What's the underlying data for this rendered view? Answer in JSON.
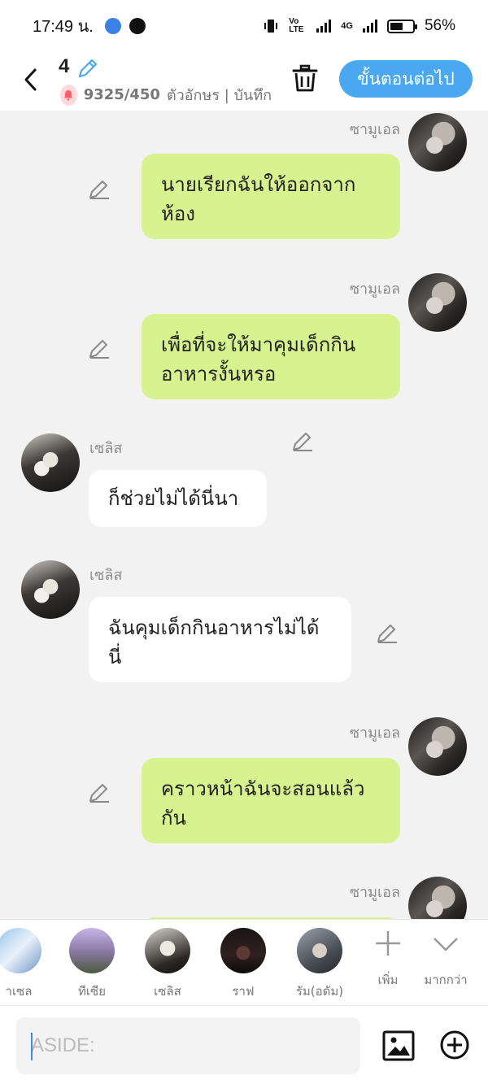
{
  "status_bar": {
    "time": "17:49 น.",
    "battery": "56%",
    "battery_level": 0.56,
    "network": "4G",
    "volte": "Vo LTE"
  },
  "header": {
    "episode_number": "4",
    "char_count": "9325/450",
    "char_count_suffix": "ตัวอักษร | บันทึก",
    "next_label": "ขั้นตอนต่อไป",
    "accent_color": "#4aa8f0"
  },
  "messages": [
    {
      "sender": "ซามูเอล",
      "side": "right",
      "text_lines": [
        "นายเรียกฉันให้ออกจาก",
        "ห้อง"
      ]
    },
    {
      "sender": "ซามูเอล",
      "side": "right",
      "text_lines": [
        "เพื่อที่จะให้มาคุมเด็กกิน",
        "อาหารงั้นหรอ"
      ]
    },
    {
      "sender": "เซลิส",
      "side": "left",
      "text_lines": [
        "ก็ช่วยไม่ได้นี่นา"
      ]
    },
    {
      "sender": "เซลิส",
      "side": "left",
      "text_lines": [
        "ฉันคุมเด็กกินอาหารไม่ได้",
        "นี่"
      ]
    },
    {
      "sender": "ซามูเอล",
      "side": "right",
      "text_lines": [
        "คราวหน้าฉันจะสอนแล้ว",
        "กัน"
      ]
    },
    {
      "sender": "ซามูเอล",
      "side": "right",
      "text_lines": []
    }
  ],
  "characters": [
    {
      "label": "าเซล"
    },
    {
      "label": "ทีเซีย"
    },
    {
      "label": "เซลิส"
    },
    {
      "label": "ราฟ"
    },
    {
      "label": "รัม(อดัม)"
    }
  ],
  "tools": {
    "add_label": "เพิ่ม",
    "more_label": "มากกว่า"
  },
  "input": {
    "placeholder": "ASIDE:"
  },
  "colors": {
    "right_bubble": "#d7f38f",
    "left_bubble": "#ffffff",
    "background": "#f2f2f2"
  }
}
